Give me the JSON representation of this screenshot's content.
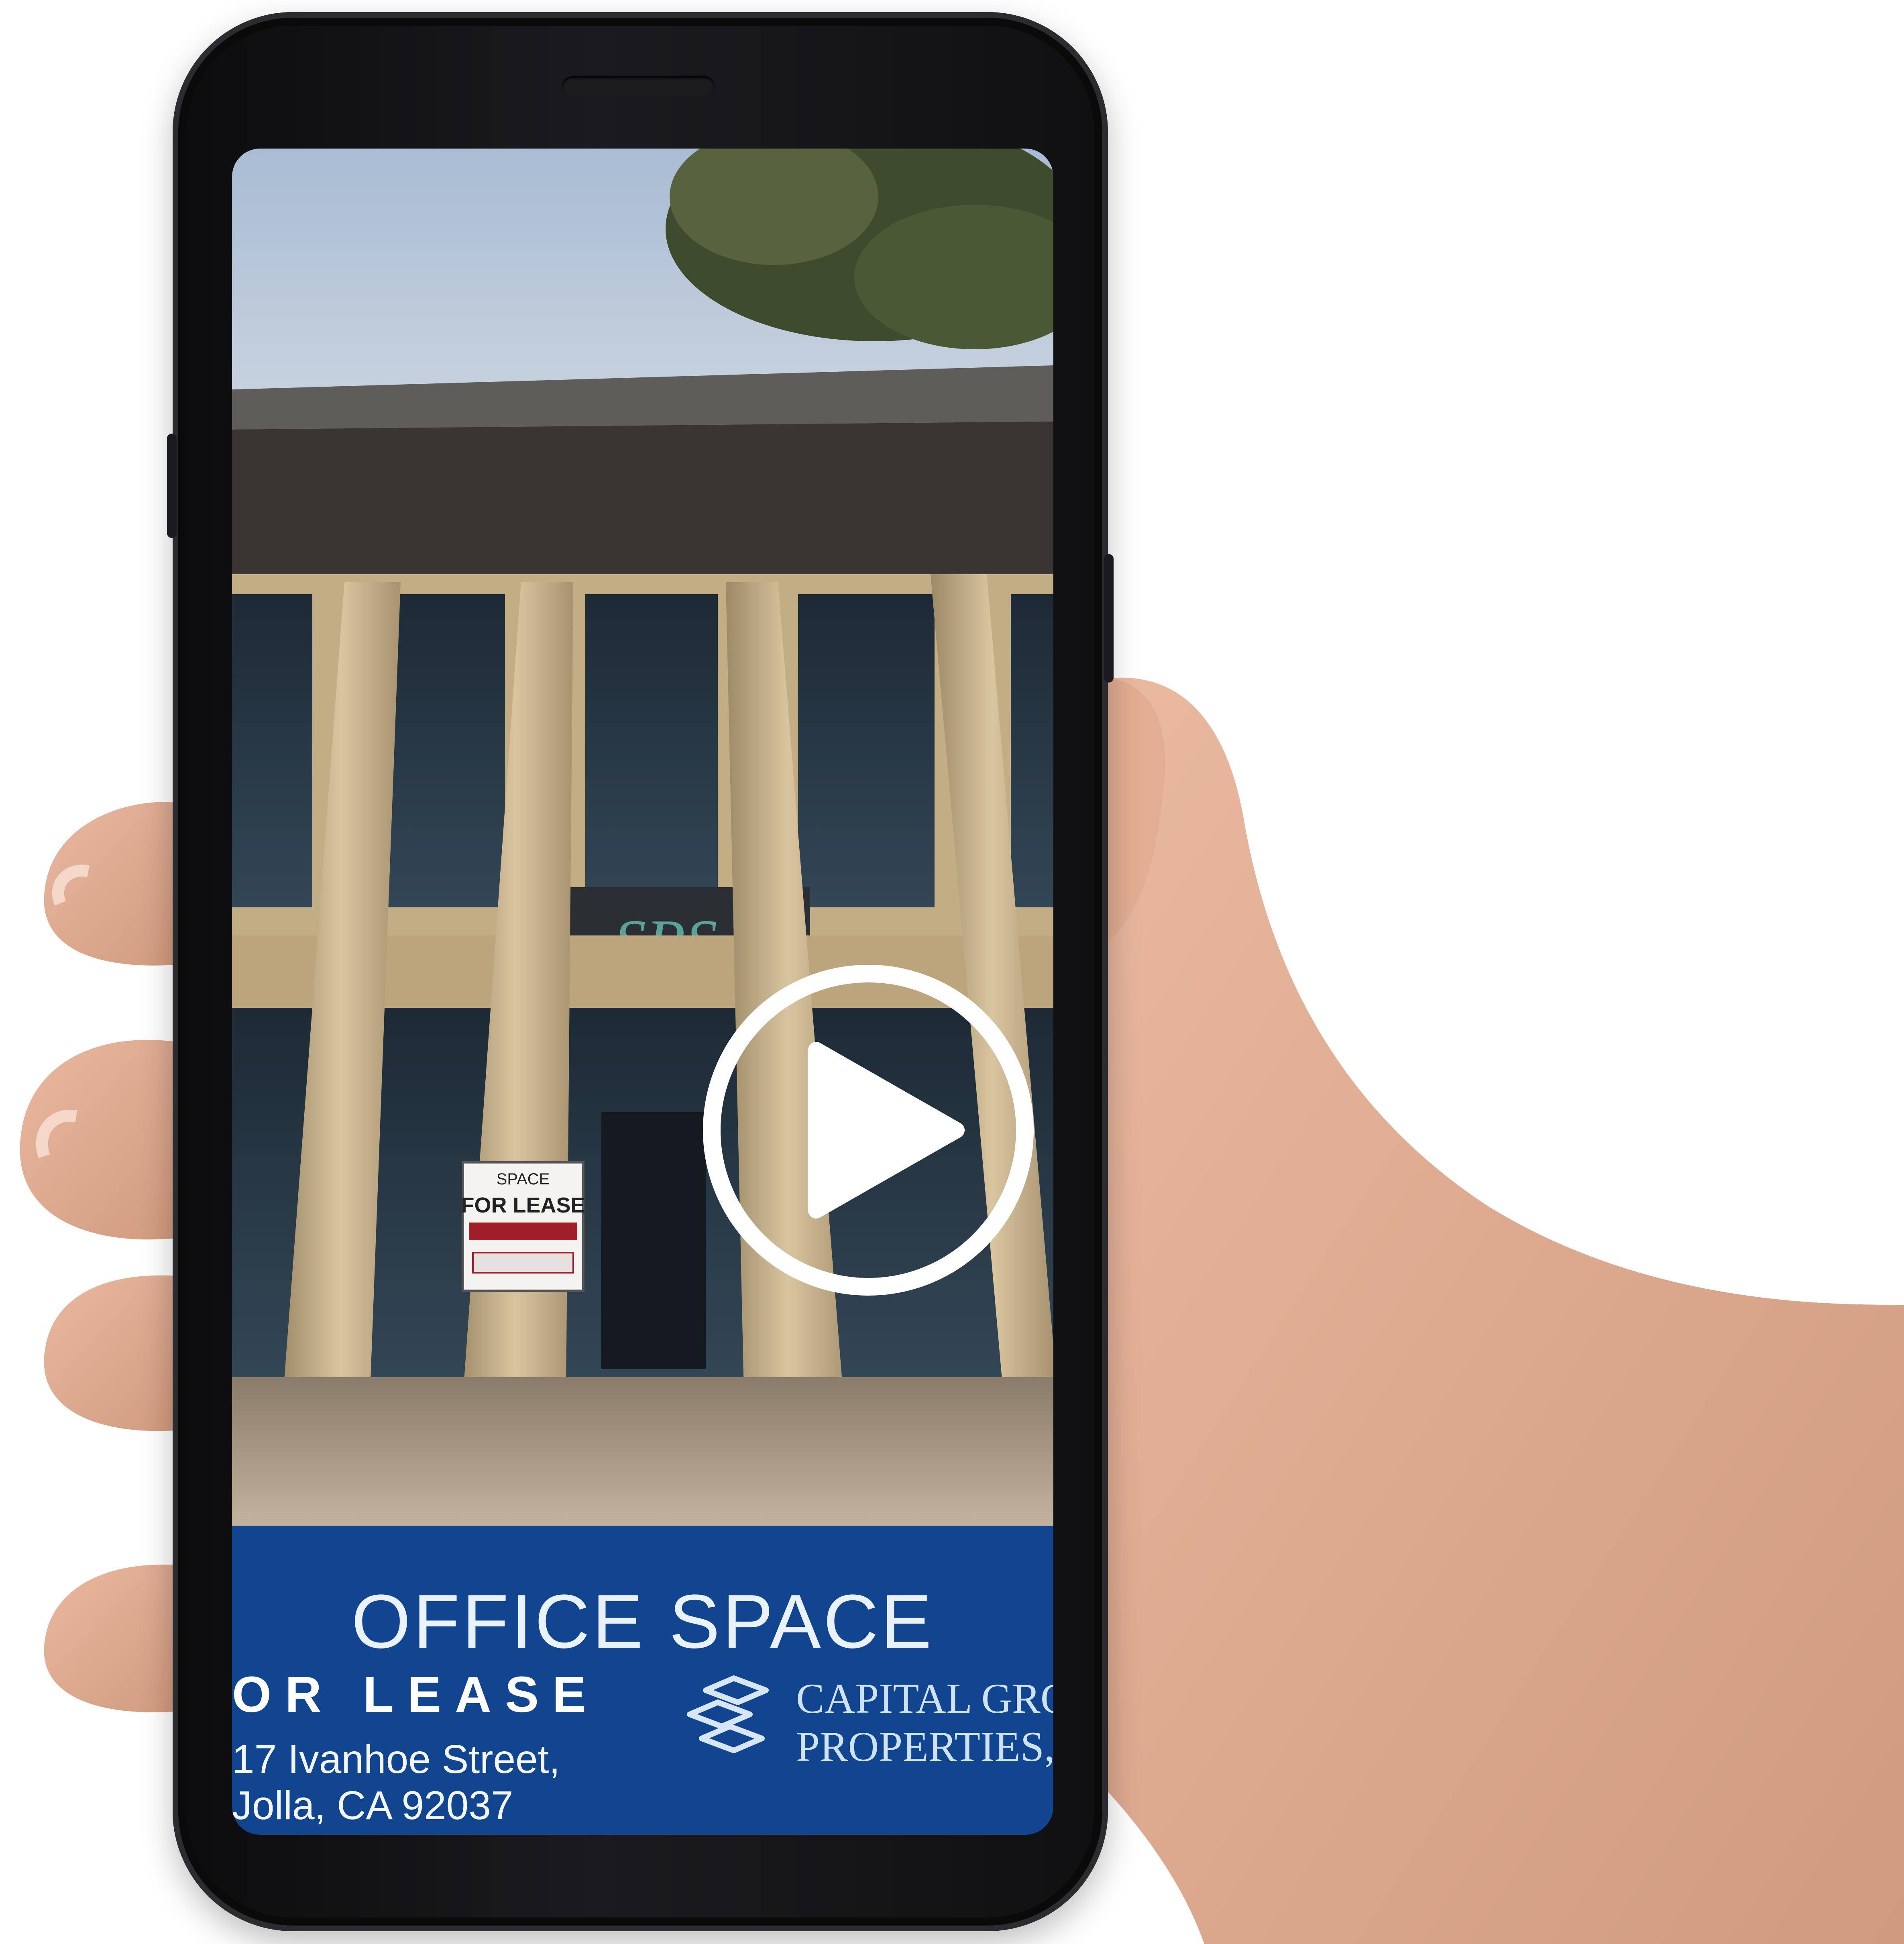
{
  "video": {
    "title": "OFFICE SPACE",
    "subtitle": "OR LEASE",
    "address_line1": "17 Ivanhoe Street,",
    "address_line2": "Jolla, CA 92037",
    "sign_line1": "SPACE",
    "sign_line2": "FOR LEASE",
    "building_sign": "SPS"
  },
  "brand": {
    "line1": "CAPITAL GROW",
    "line2": "PROPERTIES, I"
  },
  "colors": {
    "banner": "#12458f",
    "play_button": "#ffffff"
  },
  "icons": {
    "play": "play-icon",
    "logo": "capital-growth-logo-icon"
  }
}
